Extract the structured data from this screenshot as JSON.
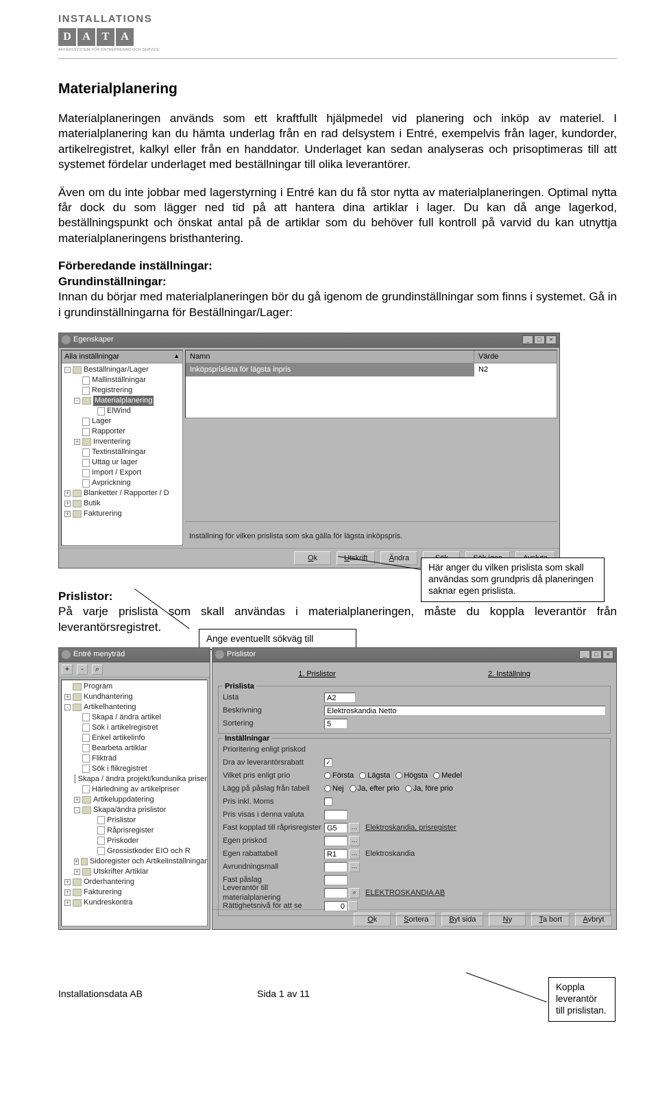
{
  "logo": {
    "top": "INSTALLATIONS",
    "boxes": [
      "D",
      "A",
      "T",
      "A"
    ],
    "sub": "AFFÄRSSYSTEM FÖR ENTREPRENAD OCH SERVICE"
  },
  "h1": "Materialplanering",
  "p1": "Materialplaneringen används som ett kraftfullt hjälpmedel vid planering och inköp av materiel. I materialplanering kan du hämta underlag från en rad delsystem i Entré, exempelvis från lager, kundorder, artikelregistret, kalkyl eller från en handdator. Underlaget kan sedan analyseras och prisoptimeras till att systemet fördelar underlaget med beställningar till olika leverantörer.",
  "p2": "Även om du inte jobbar med lagerstyrning i Entré kan du få stor nytta av materialplaneringen. Optimal nytta får dock du som lägger ned tid på att hantera dina artiklar i lager. Du kan då ange lagerkod, beställningspunkt och önskat antal på de artiklar som du behöver full kontroll på varvid du kan utnyttja materialplaneringens bristhantering.",
  "s1": "Förberedande inställningar:",
  "s2": "Grundinställningar:",
  "p3": "Innan du börjar med materialplaneringen bör du gå igenom de grundinställningar som finns i systemet. Gå in i grundinställningarna för Beställningar/Lager:",
  "callouts": {
    "c1": "Här anger du vilken prislista som skall användas som grundpris då planeringen saknar egen prislista.",
    "c2": "Ange eventuellt sökväg till",
    "c3": "Koppla leverantör till prislistan."
  },
  "egenskaper": {
    "title": "Egenskaper",
    "left_header": "Alla inställningar",
    "tree": [
      {
        "lvl": 0,
        "pm": "-",
        "t": "fold",
        "label": "Beställningar/Lager"
      },
      {
        "lvl": 1,
        "pm": "",
        "t": "doc",
        "label": "Mallinställningar"
      },
      {
        "lvl": 1,
        "pm": "",
        "t": "doc",
        "label": "Registrering"
      },
      {
        "lvl": 1,
        "pm": "-",
        "t": "fold",
        "label": "Materialplanering",
        "sel": true
      },
      {
        "lvl": 2,
        "pm": "",
        "t": "doc",
        "label": "ElWind"
      },
      {
        "lvl": 1,
        "pm": "",
        "t": "doc",
        "label": "Lager"
      },
      {
        "lvl": 1,
        "pm": "",
        "t": "doc",
        "label": "Rapporter"
      },
      {
        "lvl": 1,
        "pm": "+",
        "t": "fold",
        "label": "Inventering"
      },
      {
        "lvl": 1,
        "pm": "",
        "t": "doc",
        "label": "Textinställningar"
      },
      {
        "lvl": 1,
        "pm": "",
        "t": "doc",
        "label": "Uttag ur lager"
      },
      {
        "lvl": 1,
        "pm": "",
        "t": "doc",
        "label": "Import / Export"
      },
      {
        "lvl": 1,
        "pm": "",
        "t": "doc",
        "label": "Avprickning"
      },
      {
        "lvl": 0,
        "pm": "+",
        "t": "fold",
        "label": "Blanketter / Rapporter / D"
      },
      {
        "lvl": 0,
        "pm": "+",
        "t": "fold",
        "label": "Butik"
      },
      {
        "lvl": 0,
        "pm": "+",
        "t": "fold",
        "label": "Fakturering"
      }
    ],
    "grid_h1": "Namn",
    "grid_h2": "Värde",
    "grid_row_name": "Inköpsprislista för lägsta inpris",
    "grid_row_val": "N2",
    "hint": "Inställning för vilken prislista som ska gälla för lägsta inköpspris.",
    "buttons": [
      "Ok",
      "Utskrift",
      "Ändra",
      "Sök",
      "Sök igen",
      "Avsluta"
    ]
  },
  "s3": "Prislistor:",
  "p4": "På varje prislista som skall användas i materialplaneringen, måste du koppla leverantör från leverantörsregistret.",
  "menutree": {
    "title": "Entré menyträd",
    "toolbar": [
      "+",
      "-",
      "⌕"
    ],
    "items": [
      {
        "lvl": 0,
        "pm": "",
        "t": "fold",
        "label": "Program"
      },
      {
        "lvl": 0,
        "pm": "+",
        "t": "fold",
        "label": "Kundhantering"
      },
      {
        "lvl": 0,
        "pm": "-",
        "t": "fold",
        "label": "Artikelhantering"
      },
      {
        "lvl": 1,
        "pm": "",
        "t": "doc",
        "label": "Skapa / ändra artikel"
      },
      {
        "lvl": 1,
        "pm": "",
        "t": "doc",
        "label": "Sök i artikelregistret"
      },
      {
        "lvl": 1,
        "pm": "",
        "t": "doc",
        "label": "Enkel artikelinfo"
      },
      {
        "lvl": 1,
        "pm": "",
        "t": "doc",
        "label": "Bearbeta artiklar"
      },
      {
        "lvl": 1,
        "pm": "",
        "t": "doc",
        "label": "Flikträd"
      },
      {
        "lvl": 1,
        "pm": "",
        "t": "doc",
        "label": "Sök i flikregistret"
      },
      {
        "lvl": 1,
        "pm": "",
        "t": "doc",
        "label": "Skapa / ändra projekt/kundunika priser"
      },
      {
        "lvl": 1,
        "pm": "",
        "t": "doc",
        "label": "Härledning av artikelpriser"
      },
      {
        "lvl": 1,
        "pm": "+",
        "t": "fold",
        "label": "Artikeluppdatering"
      },
      {
        "lvl": 1,
        "pm": "-",
        "t": "fold",
        "label": "Skapa/ändra prislistor"
      },
      {
        "lvl": 2,
        "pm": "",
        "t": "doc",
        "label": "Prislistor"
      },
      {
        "lvl": 2,
        "pm": "",
        "t": "doc",
        "label": "Råprisregister"
      },
      {
        "lvl": 2,
        "pm": "",
        "t": "doc",
        "label": "Priskoder"
      },
      {
        "lvl": 2,
        "pm": "",
        "t": "doc",
        "label": "Grossistkoder EIO och R"
      },
      {
        "lvl": 1,
        "pm": "+",
        "t": "fold",
        "label": "Sidoregister och Artikelinställningar"
      },
      {
        "lvl": 1,
        "pm": "+",
        "t": "fold",
        "label": "Utskrifter Artiklar"
      },
      {
        "lvl": 0,
        "pm": "+",
        "t": "fold",
        "label": "Orderhantering"
      },
      {
        "lvl": 0,
        "pm": "+",
        "t": "fold",
        "label": "Fakturering"
      },
      {
        "lvl": 0,
        "pm": "+",
        "t": "fold",
        "label": "Kundreskontra"
      }
    ]
  },
  "prislistor": {
    "title": "Prislistor",
    "tabs": [
      "1. Prislistor",
      "2. Inställning"
    ],
    "group1": "Prislista",
    "lista_lab": "Lista",
    "lista_val": "A2",
    "beskr_lab": "Beskrivning",
    "beskr_val": "Elektroskandia Netto",
    "sort_lab": "Sortering",
    "sort_val": "5",
    "group2": "Inställningar",
    "rows": {
      "prio": "Prioritering enligt priskod",
      "dra": "Dra av leverantörsrabatt",
      "vilket": "Vilket pris enligt prio",
      "lagg": "Lägg på påslag från tabell",
      "pris": "Pris inkl. Moms",
      "visas": "Pris visas i denna valuta",
      "fast_rap": "Fast kopplad till råprisregister",
      "egen_pris": "Egen priskod",
      "egen_rab": "Egen rabattabell",
      "avr": "Avrundningsmall",
      "fast_p": "Fast påslag",
      "lev": "Leverantör till materialplanering",
      "ratt": "Rättighetsnivå för att se"
    },
    "radios1": [
      "Första",
      "Lägsta",
      "Högsta",
      "Medel"
    ],
    "radios2": [
      "Nej",
      "Ja, efter prio",
      "Ja, före prio"
    ],
    "fast_rap_val": "G5",
    "fast_rap_txt": "Elektroskandia, prisregister",
    "egen_rab_val": "R1",
    "egen_rab_txt": "Elektroskandia",
    "lev_txt": "ELEKTROSKANDIA AB",
    "ratt_val": "0",
    "buttons": [
      "Ok",
      "Sortera",
      "Byt sida",
      "Ny",
      "Ta bort",
      "Avbryt"
    ]
  },
  "footer": {
    "company": "Installationsdata AB",
    "page": "Sida 1 av 11"
  }
}
